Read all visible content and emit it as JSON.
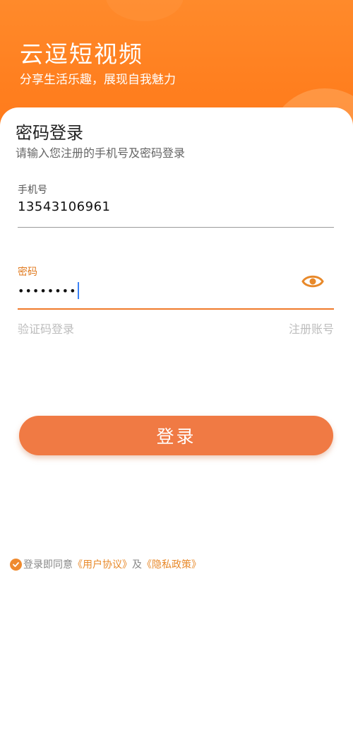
{
  "header": {
    "app_title": "云逗短视频",
    "slogan": "分享生活乐趣，展现自我魅力"
  },
  "login": {
    "title": "密码登录",
    "subtitle": "请输入您注册的手机号及密码登录",
    "phone_label": "手机号",
    "phone_value": "13543106961",
    "password_label": "密码",
    "password_masked": "••••••••",
    "sms_login_link": "验证码登录",
    "register_link": "注册账号",
    "submit_label": "登录"
  },
  "agreement": {
    "prefix": "登录即同意",
    "user_agreement": "《用户协议》",
    "conjunction": "及",
    "privacy_policy": "《隐私政策》"
  },
  "colors": {
    "brand_orange": "#ff7f1f",
    "button": "#f07a44",
    "link": "#e8892a",
    "caret": "#3b82f6"
  },
  "icons": [
    "eye-icon",
    "check-circle-icon"
  ]
}
